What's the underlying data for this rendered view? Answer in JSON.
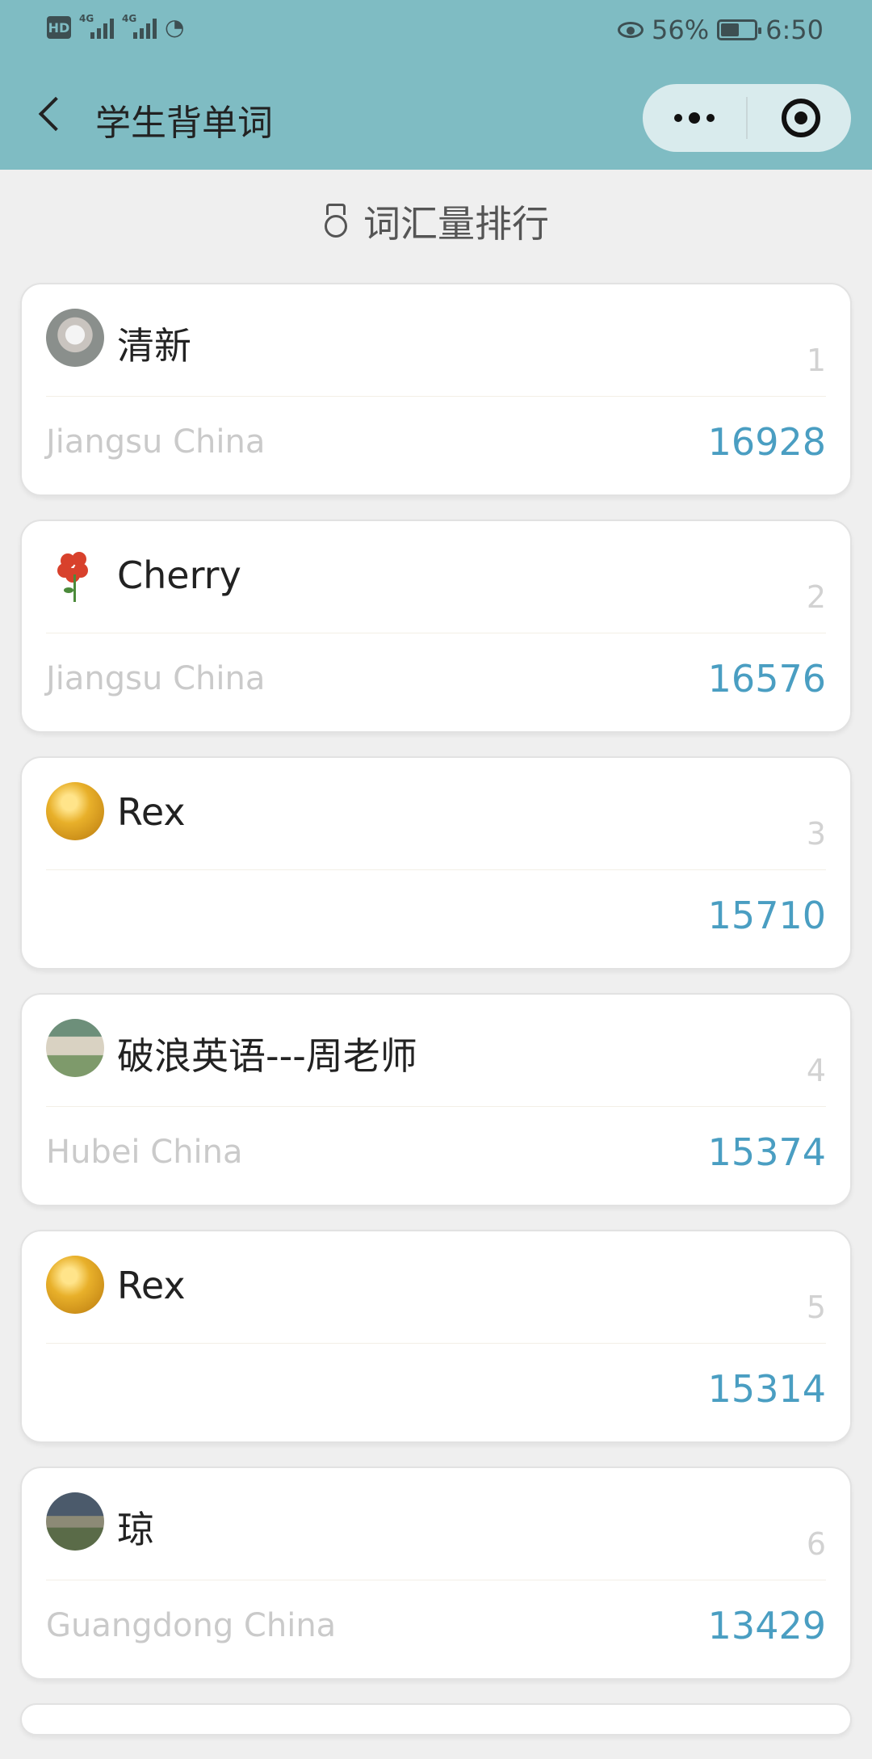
{
  "status_bar": {
    "left_badge": "HD",
    "signal_1": "4G",
    "signal_2": "4G",
    "battery_percent": "56%",
    "battery_level": 0.56,
    "time": "6:50"
  },
  "nav": {
    "title": "学生背单词"
  },
  "section": {
    "title": "词汇量排行",
    "icon": "medal-icon"
  },
  "leaderboard": [
    {
      "name": "清新",
      "rank": "1",
      "location": "Jiangsu China",
      "score": "16928"
    },
    {
      "name": "Cherry",
      "rank": "2",
      "location": "Jiangsu China",
      "score": "16576"
    },
    {
      "name": "Rex",
      "rank": "3",
      "location": "",
      "score": "15710"
    },
    {
      "name": "破浪英语---周老师",
      "rank": "4",
      "location": "Hubei China",
      "score": "15374"
    },
    {
      "name": "Rex",
      "rank": "5",
      "location": "",
      "score": "15314"
    },
    {
      "name": "琼",
      "rank": "6",
      "location": "Guangdong China",
      "score": "13429"
    }
  ],
  "colors": {
    "header_bg": "#7fbcc3",
    "score": "#4a9ec2",
    "page_bg": "#efefef"
  }
}
